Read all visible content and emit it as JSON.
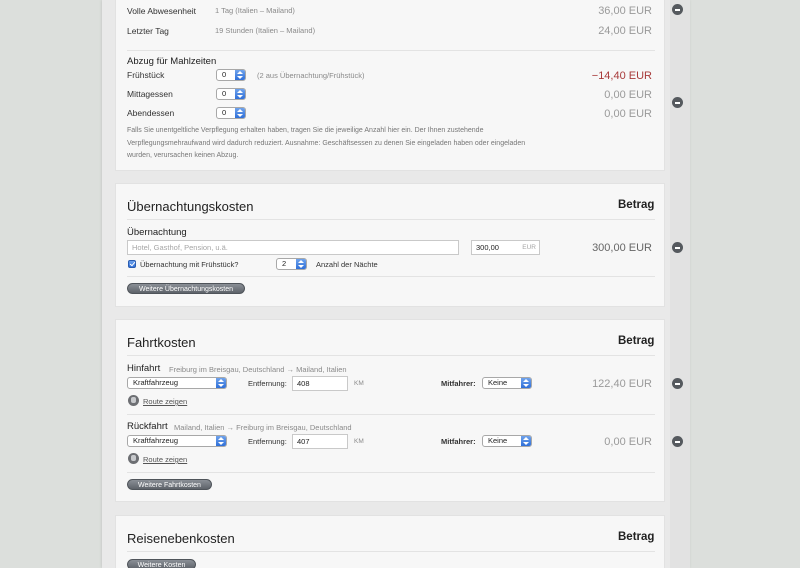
{
  "colors": {
    "negative_amount": "#a83a3a",
    "accent_blue": "#2f6fd8"
  },
  "verpflegung": {
    "rows": [
      {
        "label": "Volle Abwesenheit",
        "detail": "1 Tag (Italien – Mailand)",
        "amount": "36,00 EUR"
      },
      {
        "label": "Letzter Tag",
        "detail": "19 Stunden (Italien – Mailand)",
        "amount": "24,00 EUR"
      }
    ],
    "abzug_title": "Abzug für Mahlzeiten",
    "meals": [
      {
        "label": "Frühstück",
        "value": "0",
        "note": "(2 aus Übernachtung/Frühstück)",
        "amount": "−14,40 EUR"
      },
      {
        "label": "Mittagessen",
        "value": "0",
        "note": "",
        "amount": "0,00 EUR"
      },
      {
        "label": "Abendessen",
        "value": "0",
        "note": "",
        "amount": "0,00 EUR"
      }
    ],
    "description": "Falls Sie unentgeltliche Verpflegung erhalten haben, tragen Sie die jeweilige Anzahl hier ein. Der Ihnen zustehende Verpflegungsmehraufwand wird dadurch reduziert. Ausnahme: Geschäftsessen zu denen Sie eingeladen haben oder eingeladen wurden, verursachen keinen Abzug."
  },
  "uebernachtung": {
    "title": "Übernachtungskosten",
    "amount_header": "Betrag",
    "item_label": "Übernachtung",
    "place_placeholder": "Hotel, Gasthof, Pension, u.ä.",
    "price_value": "300,00",
    "price_unit": "EUR",
    "breakfast_label": "Übernachtung mit Frühstück?",
    "nights_value": "2",
    "nights_label": "Anzahl der Nächte",
    "amount": "300,00 EUR",
    "more_button": "Weitere Übernachtungskosten"
  },
  "fahrt": {
    "title": "Fahrtkosten",
    "amount_header": "Betrag",
    "trips": [
      {
        "label": "Hinfahrt",
        "route": "Freiburg im Breisgau, Deutschland → Mailand, Italien",
        "vehicle": "Kraftfahrzeug",
        "distance_label": "Entfernung:",
        "distance": "408",
        "distance_unit": "KM",
        "passenger_label": "Mitfahrer:",
        "passenger": "Keine",
        "route_link": "Route zeigen",
        "amount": "122,40 EUR"
      },
      {
        "label": "Rückfahrt",
        "route": "Mailand, Italien → Freiburg im Breisgau, Deutschland",
        "vehicle": "Kraftfahrzeug",
        "distance_label": "Entfernung:",
        "distance": "407",
        "distance_unit": "KM",
        "passenger_label": "Mitfahrer:",
        "passenger": "Keine",
        "route_link": "Route zeigen",
        "amount": "0,00 EUR"
      }
    ],
    "more_button": "Weitere Fahrtkosten"
  },
  "neben": {
    "title": "Reisenebenkosten",
    "amount_header": "Betrag",
    "more_button": "Weitere Kosten"
  }
}
